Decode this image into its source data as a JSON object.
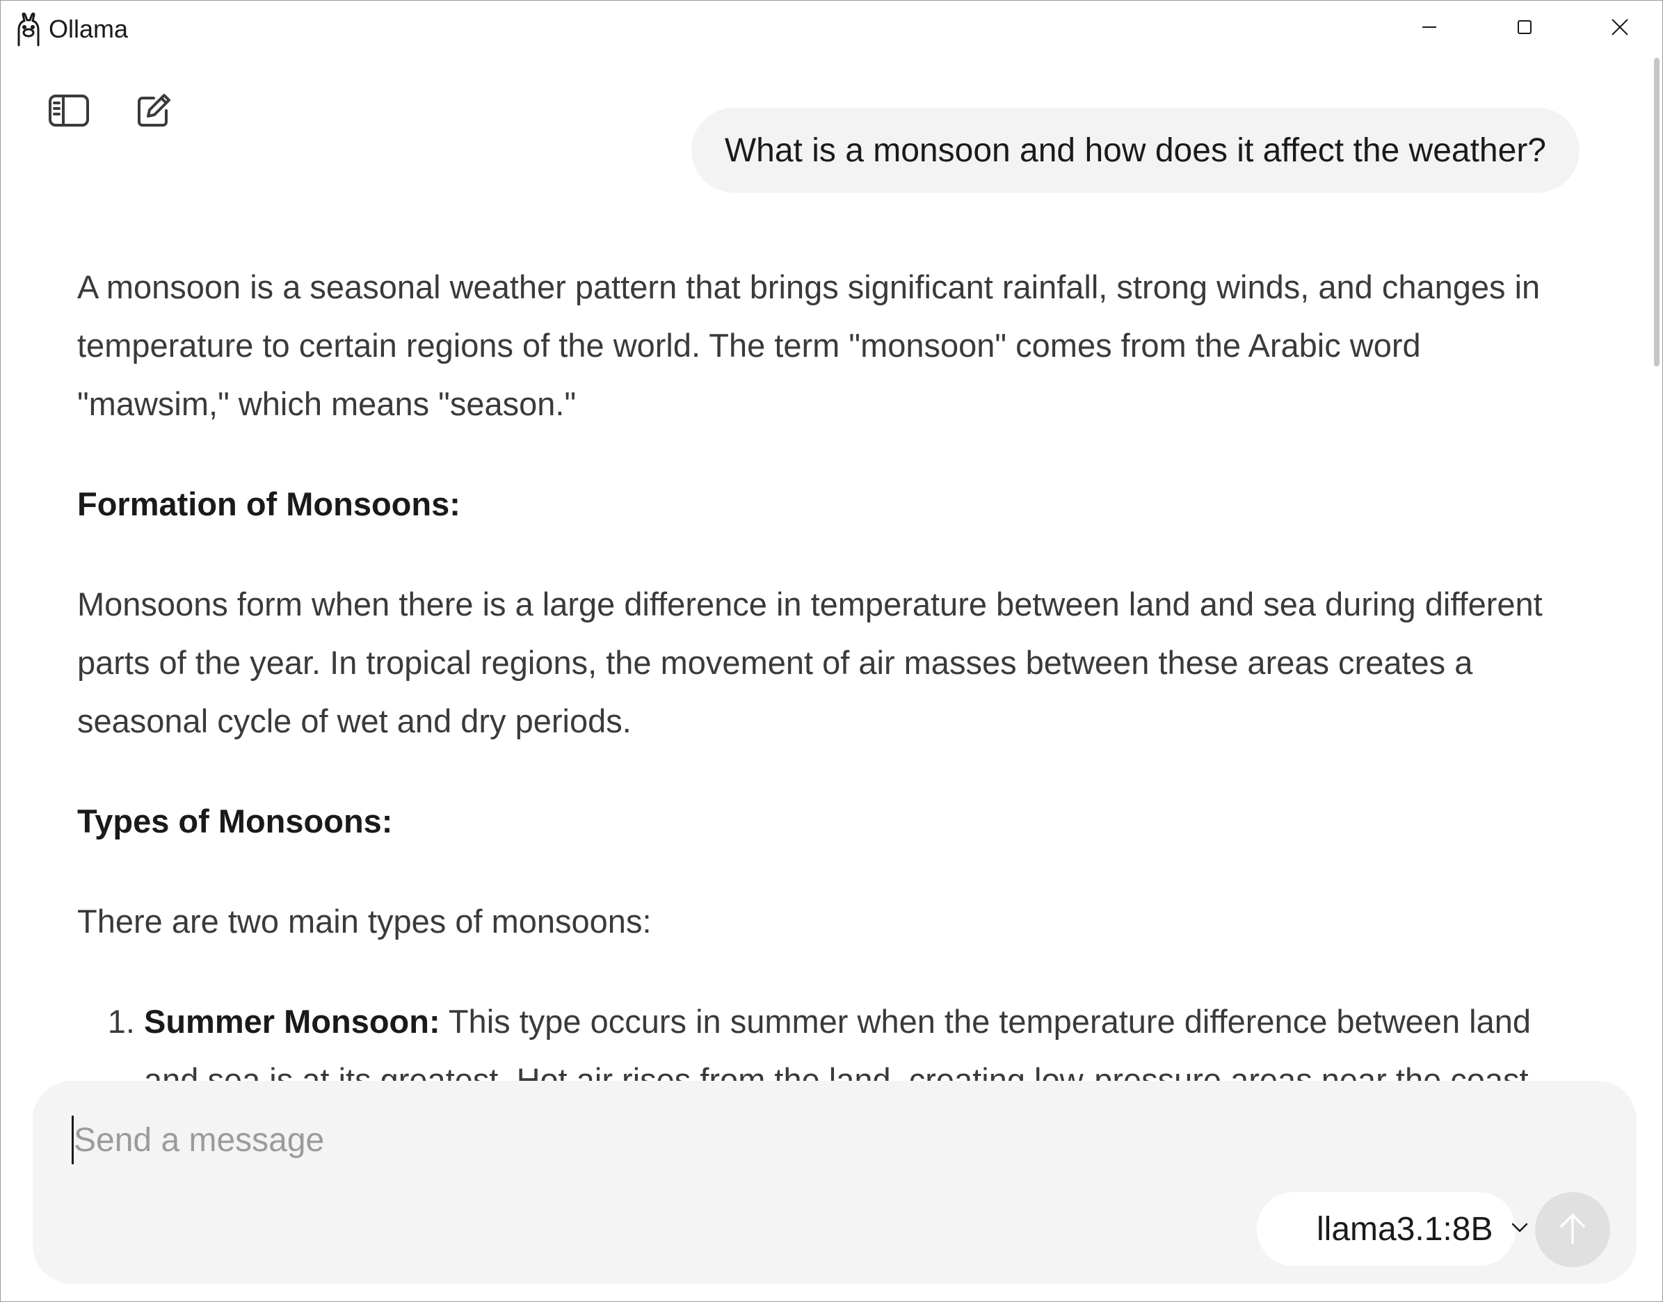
{
  "window": {
    "title": "Ollama"
  },
  "conversation": {
    "user_message": "What is a monsoon and how does it affect the weather?",
    "response": {
      "intro": "A monsoon is a seasonal weather pattern that brings significant rainfall, strong winds, and changes in temperature to certain regions of the world. The term \"monsoon\" comes from the Arabic word \"mawsim,\" which means \"season.\"",
      "heading_formation": "Formation of Monsoons:",
      "formation_text": "Monsoons form when there is a large difference in temperature between land and sea during different parts of the year. In tropical regions, the movement of air masses between these areas creates a seasonal cycle of wet and dry periods.",
      "heading_types": "Types of Monsoons:",
      "types_intro": "There are two main types of monsoons:",
      "list": [
        {
          "title": "Summer Monsoon:",
          "text": "This type occurs in summer when the temperature difference between land and sea is at its greatest. Hot air rises from the land, creating low-pressure areas near the coast."
        }
      ]
    }
  },
  "composer": {
    "placeholder": "Send a message",
    "value": ""
  },
  "model": {
    "selected": "llama3.1:8B"
  },
  "icons": {
    "sidebar": "sidebar-toggle-icon",
    "new_chat": "new-chat-icon",
    "minimize": "minimize-icon",
    "maximize": "maximize-icon",
    "close": "close-icon",
    "dropdown": "chevron-down-icon",
    "send": "arrow-up-icon"
  }
}
